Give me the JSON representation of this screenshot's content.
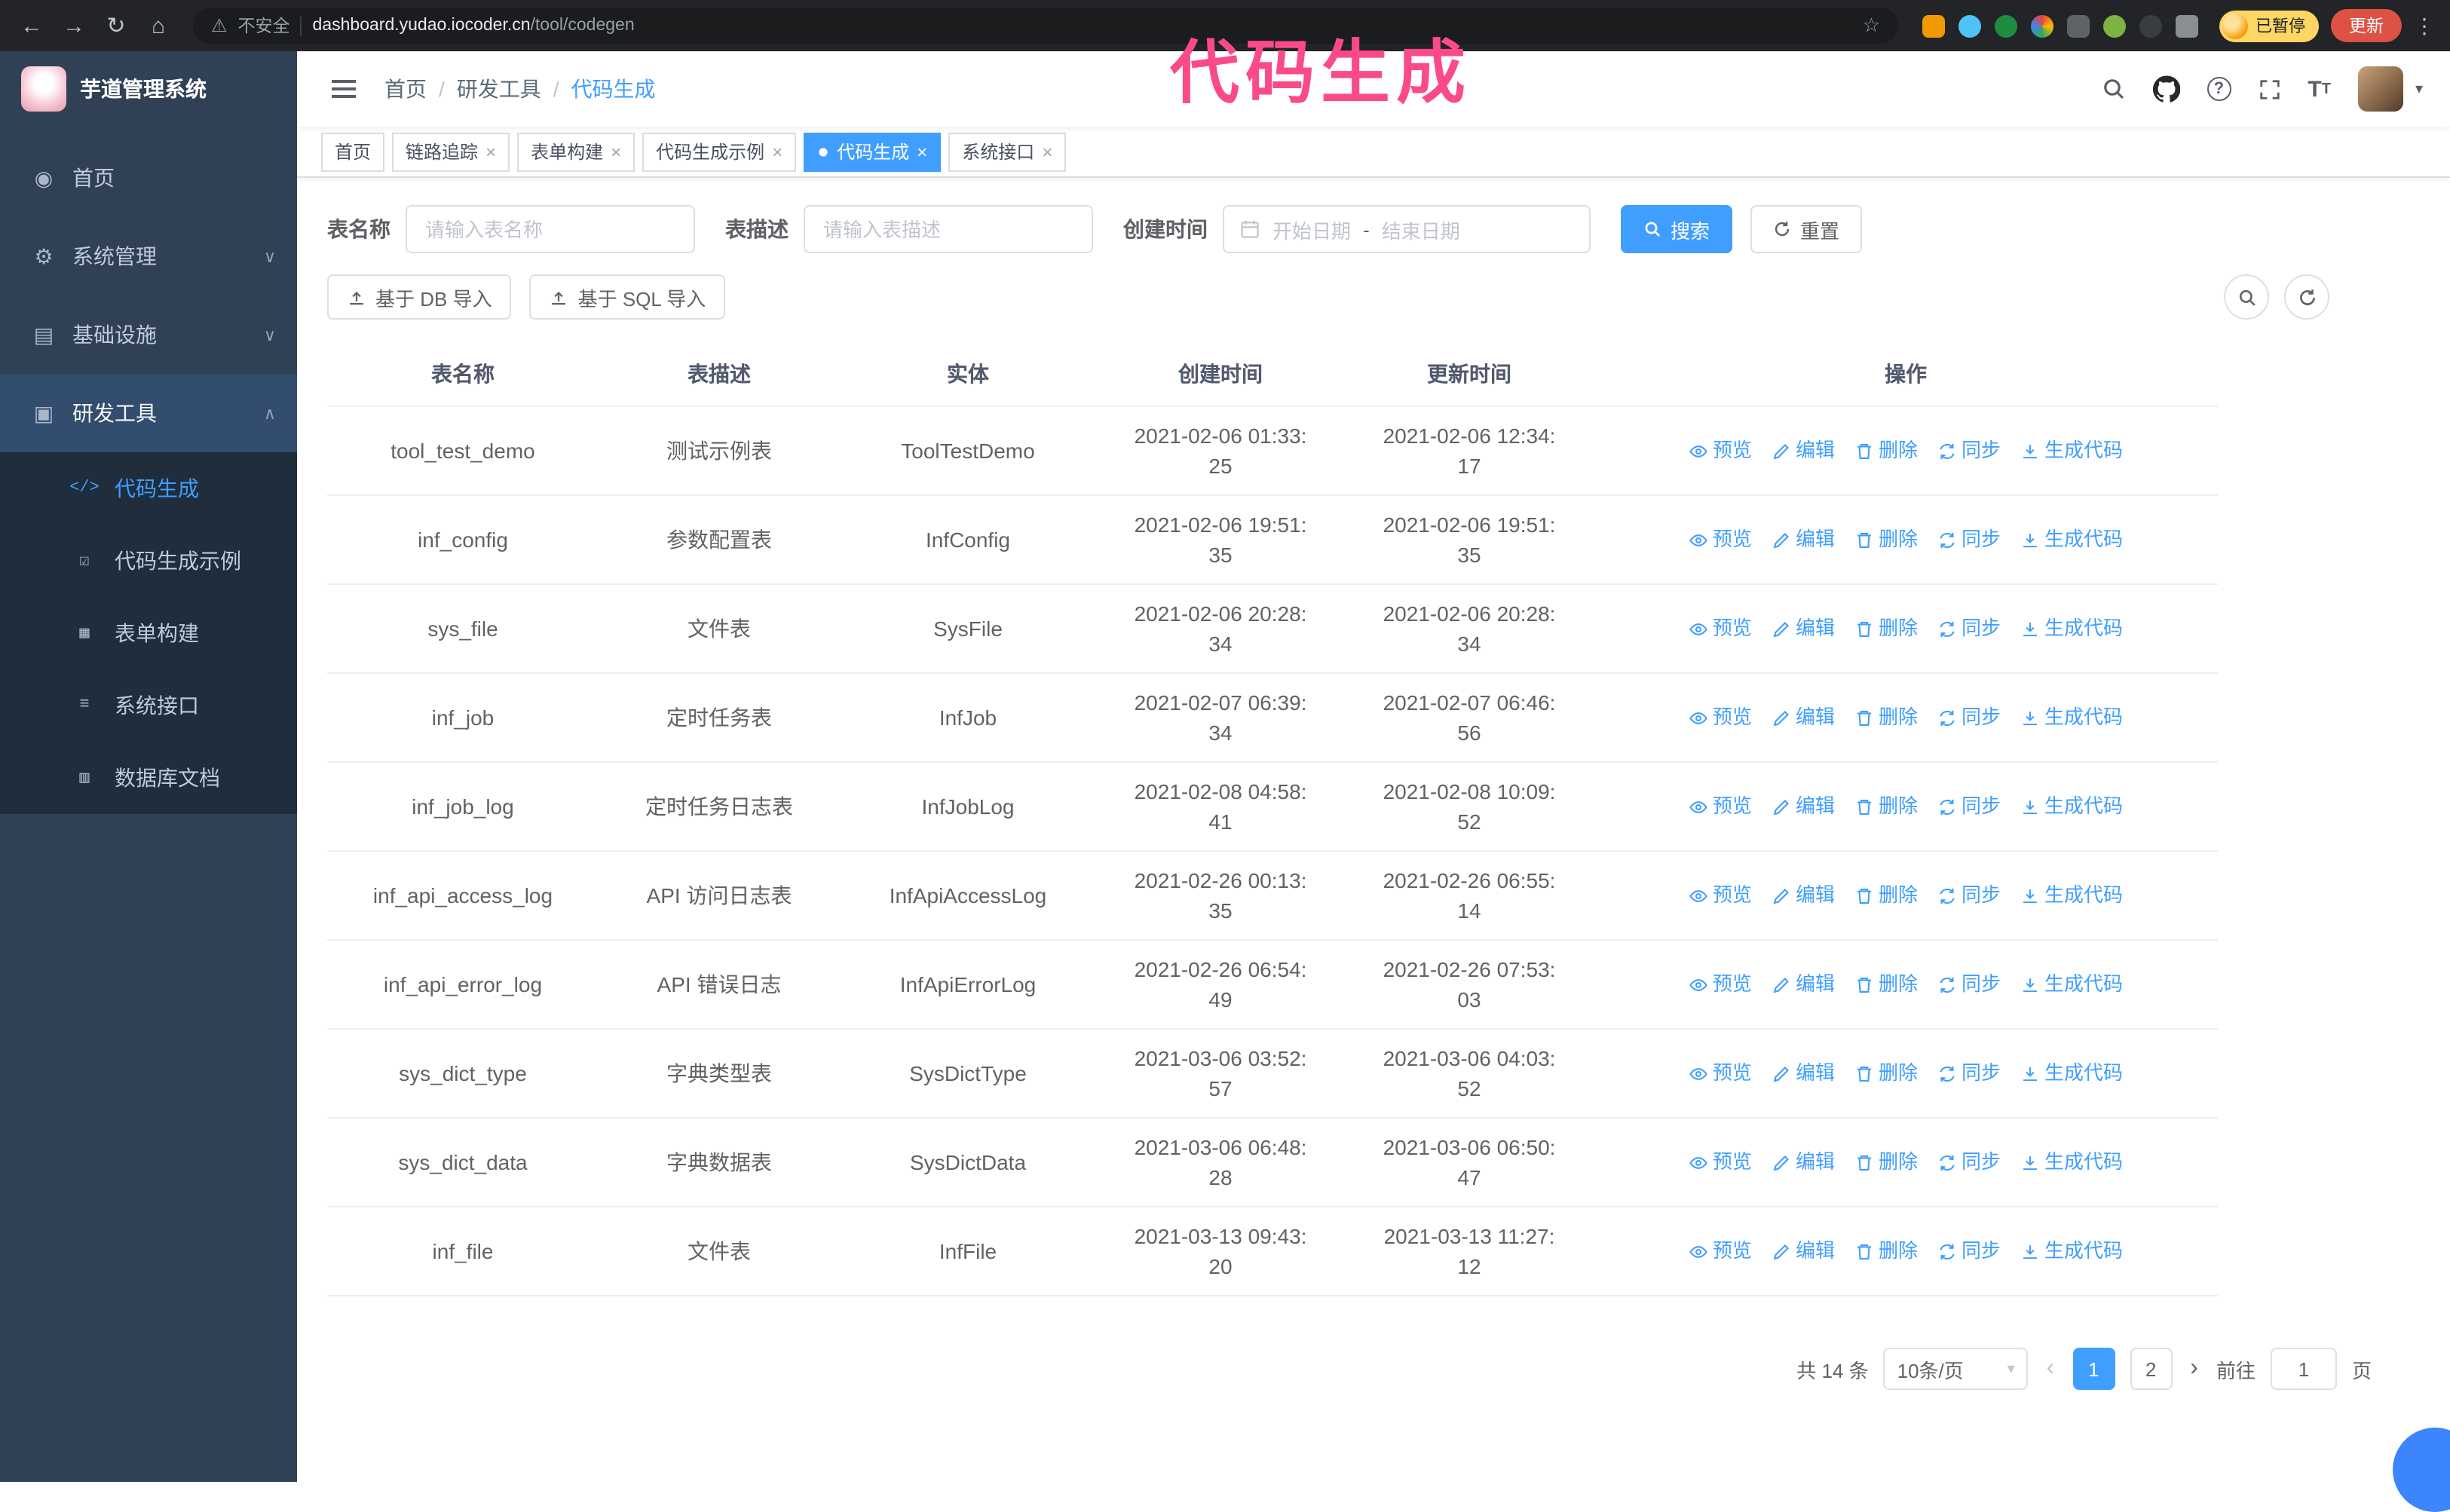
{
  "browser": {
    "security_label": "不安全",
    "url_host": "dashboard.yudao.iocoder.cn",
    "url_path": "/tool/codegen",
    "paused_badge": "已暂停",
    "update_button": "更新"
  },
  "overlay": {
    "annotation": "代码生成"
  },
  "sidebar": {
    "logo_title": "芋道管理系统",
    "items": [
      {
        "label": "首页"
      },
      {
        "label": "系统管理"
      },
      {
        "label": "基础设施"
      },
      {
        "label": "研发工具"
      }
    ],
    "submenu": [
      {
        "label": "代码生成"
      },
      {
        "label": "代码生成示例"
      },
      {
        "label": "表单构建"
      },
      {
        "label": "系统接口"
      },
      {
        "label": "数据库文档"
      }
    ]
  },
  "header": {
    "breadcrumb": [
      "首页",
      "研发工具",
      "代码生成"
    ]
  },
  "tabs": [
    {
      "label": "首页"
    },
    {
      "label": "链路追踪"
    },
    {
      "label": "表单构建"
    },
    {
      "label": "代码生成示例"
    },
    {
      "label": "代码生成"
    },
    {
      "label": "系统接口"
    }
  ],
  "filters": {
    "table_name_label": "表名称",
    "table_name_placeholder": "请输入表名称",
    "table_desc_label": "表描述",
    "table_desc_placeholder": "请输入表描述",
    "create_time_label": "创建时间",
    "date_start": "开始日期",
    "date_separator": "-",
    "date_end": "结束日期",
    "search_button": "搜索",
    "reset_button": "重置"
  },
  "toolbar": {
    "import_db": "基于 DB 导入",
    "import_sql": "基于 SQL 导入"
  },
  "table": {
    "columns": [
      "表名称",
      "表描述",
      "实体",
      "创建时间",
      "更新时间",
      "操作"
    ],
    "actions": [
      "预览",
      "编辑",
      "删除",
      "同步",
      "生成代码"
    ],
    "rows": [
      {
        "name": "tool_test_demo",
        "desc": "测试示例表",
        "entity": "ToolTestDemo",
        "created": "2021-02-06 01:33:25",
        "updated": "2021-02-06 12:34:17"
      },
      {
        "name": "inf_config",
        "desc": "参数配置表",
        "entity": "InfConfig",
        "created": "2021-02-06 19:51:35",
        "updated": "2021-02-06 19:51:35"
      },
      {
        "name": "sys_file",
        "desc": "文件表",
        "entity": "SysFile",
        "created": "2021-02-06 20:28:34",
        "updated": "2021-02-06 20:28:34"
      },
      {
        "name": "inf_job",
        "desc": "定时任务表",
        "entity": "InfJob",
        "created": "2021-02-07 06:39:34",
        "updated": "2021-02-07 06:46:56"
      },
      {
        "name": "inf_job_log",
        "desc": "定时任务日志表",
        "entity": "InfJobLog",
        "created": "2021-02-08 04:58:41",
        "updated": "2021-02-08 10:09:52"
      },
      {
        "name": "inf_api_access_log",
        "desc": "API 访问日志表",
        "entity": "InfApiAccessLog",
        "created": "2021-02-26 00:13:35",
        "updated": "2021-02-26 06:55:14"
      },
      {
        "name": "inf_api_error_log",
        "desc": "API 错误日志",
        "entity": "InfApiErrorLog",
        "created": "2021-02-26 06:54:49",
        "updated": "2021-02-26 07:53:03"
      },
      {
        "name": "sys_dict_type",
        "desc": "字典类型表",
        "entity": "SysDictType",
        "created": "2021-03-06 03:52:57",
        "updated": "2021-03-06 04:03:52"
      },
      {
        "name": "sys_dict_data",
        "desc": "字典数据表",
        "entity": "SysDictData",
        "created": "2021-03-06 06:48:28",
        "updated": "2021-03-06 06:50:47"
      },
      {
        "name": "inf_file",
        "desc": "文件表",
        "entity": "InfFile",
        "created": "2021-03-13 09:43:20",
        "updated": "2021-03-13 11:27:12"
      }
    ]
  },
  "pagination": {
    "total_text": "共 14 条",
    "page_size": "10条/页",
    "pages": [
      "1",
      "2"
    ],
    "goto_label": "前往",
    "goto_value": "1",
    "goto_suffix": "页"
  },
  "colors": {
    "accent": "#409eff",
    "sidebar": "#304156",
    "annotation": "#fb4a8a"
  },
  "icons": {
    "back": "←",
    "forward": "→",
    "reload": "↻",
    "home": "⌂",
    "warning": "⚠",
    "star": "☆",
    "kebab": "⋮",
    "breadcrumb_separator": "/",
    "caret_down": "▾",
    "question_mark": "?",
    "chevron_down": "∨",
    "chevron_up": "∧",
    "close": "×",
    "font_letter": "T",
    "page_prev": "‹",
    "page_next": "›",
    "menu_dashboard": "◉",
    "menu_system": "⚙",
    "menu_infra": "▤",
    "menu_dev": "▣",
    "menu_codegen": "</>",
    "menu_codegen_demo": "☑",
    "menu_form": "▦",
    "menu_api": "≡",
    "menu_db": "▥"
  }
}
